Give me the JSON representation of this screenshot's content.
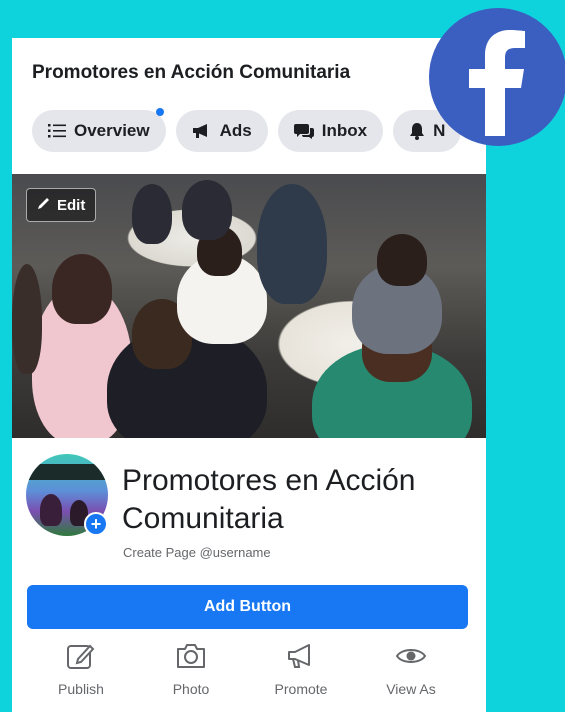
{
  "header": {
    "title": "Promotores en Acción Comunitaria"
  },
  "tabs": [
    {
      "label": "Overview",
      "icon": "list-icon",
      "has_dot": true
    },
    {
      "label": "Ads",
      "icon": "megaphone-icon"
    },
    {
      "label": "Inbox",
      "icon": "chat-bubbles-icon"
    },
    {
      "label": "N",
      "icon": "bell-icon"
    }
  ],
  "cover": {
    "edit_label": "Edit"
  },
  "profile": {
    "name": "Promotores en Acción Comunitaria",
    "subtext": "Create Page @username"
  },
  "add_button": {
    "label": "Add Button"
  },
  "actions": [
    {
      "label": "Publish",
      "icon": "compose-icon"
    },
    {
      "label": "Photo",
      "icon": "camera-icon"
    },
    {
      "label": "Promote",
      "icon": "megaphone-icon"
    },
    {
      "label": "View As",
      "icon": "eye-icon"
    }
  ],
  "colors": {
    "background": "#0fd3dc",
    "facebook_blue": "#1877f2",
    "facebook_logo": "#3b5fc0"
  }
}
